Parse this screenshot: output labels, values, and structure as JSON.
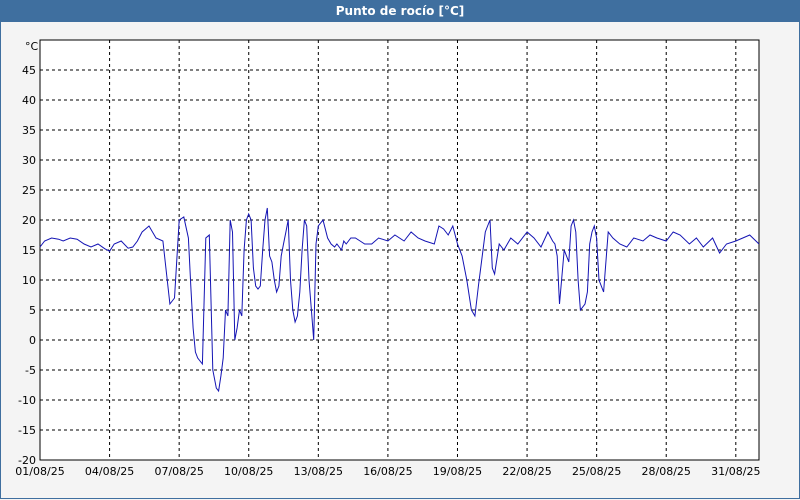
{
  "window": {
    "title": "Punto de rocío [°C]"
  },
  "colors": {
    "titlebar": "#3f6f9f",
    "series": "#1414b4",
    "grid": "#000000",
    "plot_bg": "#ffffff",
    "page_bg": "#f4f4f4"
  },
  "chart_data": {
    "type": "line",
    "title": "Punto de rocío [°C]",
    "ylabel": "°C",
    "xlabel": "",
    "xlim": [
      "01/08/25",
      "01/09/25"
    ],
    "ylim": [
      -20,
      50
    ],
    "grid": true,
    "x_ticks": [
      "01/08/25",
      "04/08/25",
      "07/08/25",
      "10/08/25",
      "13/08/25",
      "16/08/25",
      "19/08/25",
      "22/08/25",
      "25/08/25",
      "28/08/25",
      "31/08/25"
    ],
    "y_ticks": [
      -20,
      -15,
      -10,
      -5,
      0,
      5,
      10,
      15,
      20,
      25,
      30,
      35,
      40,
      45
    ],
    "series": [
      {
        "x_days": [
          0,
          0.2,
          0.5,
          0.8,
          1,
          1.3,
          1.6,
          1.9,
          2.2,
          2.5,
          2.8,
          3,
          3.2,
          3.5,
          3.8,
          4,
          4.2,
          4.4,
          4.7,
          5,
          5.3,
          5.6,
          5.8,
          6,
          6.2,
          6.4,
          6.5,
          6.6,
          6.7,
          6.8,
          7,
          7.15,
          7.3,
          7.45,
          7.6,
          7.7,
          7.8,
          7.9,
          8,
          8.1,
          8.2,
          8.3,
          8.4,
          8.5,
          8.6,
          8.7,
          8.8,
          8.9,
          9,
          9.1,
          9.2,
          9.3,
          9.4,
          9.5,
          9.6,
          9.7,
          9.8,
          9.9,
          10,
          10.1,
          10.2,
          10.3,
          10.4,
          10.5,
          10.6,
          10.7,
          10.8,
          10.9,
          11,
          11.1,
          11.2,
          11.3,
          11.4,
          11.5,
          11.6,
          11.7,
          11.8,
          11.9,
          12,
          12.2,
          12.4,
          12.55,
          12.7,
          12.8,
          12.9,
          13,
          13.1,
          13.2,
          13.4,
          13.6,
          13.8,
          14,
          14.3,
          14.6,
          15,
          15.3,
          15.7,
          16,
          16.3,
          16.6,
          17,
          17.2,
          17.4,
          17.6,
          17.8,
          18,
          18.2,
          18.4,
          18.6,
          18.75,
          18.9,
          19,
          19.1,
          19.2,
          19.3,
          19.4,
          19.5,
          19.6,
          19.8,
          20,
          20.3,
          20.6,
          21,
          21.3,
          21.6,
          21.9,
          22.1,
          22.2,
          22.3,
          22.4,
          22.6,
          22.8,
          22.9,
          23,
          23.1,
          23.2,
          23.3,
          23.5,
          23.6,
          23.7,
          23.8,
          23.9,
          24,
          24.1,
          24.3,
          24.5,
          24.7,
          25,
          25.3,
          25.6,
          26,
          26.3,
          26.6,
          27,
          27.3,
          27.6,
          28,
          28.3,
          28.6,
          29,
          29.3,
          29.6,
          30,
          30.3,
          30.6,
          31
        ],
        "values": [
          15.5,
          16.5,
          17,
          16.8,
          16.5,
          17,
          16.8,
          16,
          15.5,
          16,
          15.2,
          14.8,
          16,
          16.5,
          15.3,
          15.5,
          16.5,
          18,
          19,
          17,
          16.5,
          6,
          7,
          20,
          20.5,
          17,
          9,
          2,
          -2,
          -3,
          -4,
          17,
          17.5,
          -5,
          -8,
          -8.5,
          -6,
          -3,
          5,
          4,
          20,
          18,
          0,
          2,
          5,
          4,
          15,
          20,
          21,
          20,
          12,
          9,
          8.5,
          9,
          15,
          20,
          22,
          14,
          13,
          10,
          8,
          9,
          14,
          16,
          18,
          20,
          10,
          5,
          3,
          4,
          8,
          15,
          20,
          19,
          10,
          5,
          0,
          16,
          19,
          20,
          17,
          16,
          15.5,
          16,
          15.5,
          15,
          16.5,
          16,
          17,
          17,
          16.5,
          16,
          16,
          17,
          16.5,
          17.5,
          16.5,
          18,
          17,
          16.5,
          16,
          19,
          18.5,
          17.5,
          19,
          16,
          14,
          10,
          5,
          4,
          9,
          12,
          15,
          18,
          19,
          20,
          12,
          11,
          16,
          15,
          17,
          16,
          18,
          17,
          15.5,
          18,
          16.5,
          16,
          14,
          6,
          15,
          13,
          19,
          20,
          18,
          10,
          5,
          6,
          8,
          16,
          18,
          19,
          17,
          10,
          8,
          18,
          17,
          16,
          15.5,
          17,
          16.5,
          17.5,
          17,
          16.5,
          18,
          17.5,
          16,
          17,
          15.5,
          17,
          14.5,
          16,
          16.5,
          17,
          17.5,
          16
        ]
      }
    ]
  }
}
